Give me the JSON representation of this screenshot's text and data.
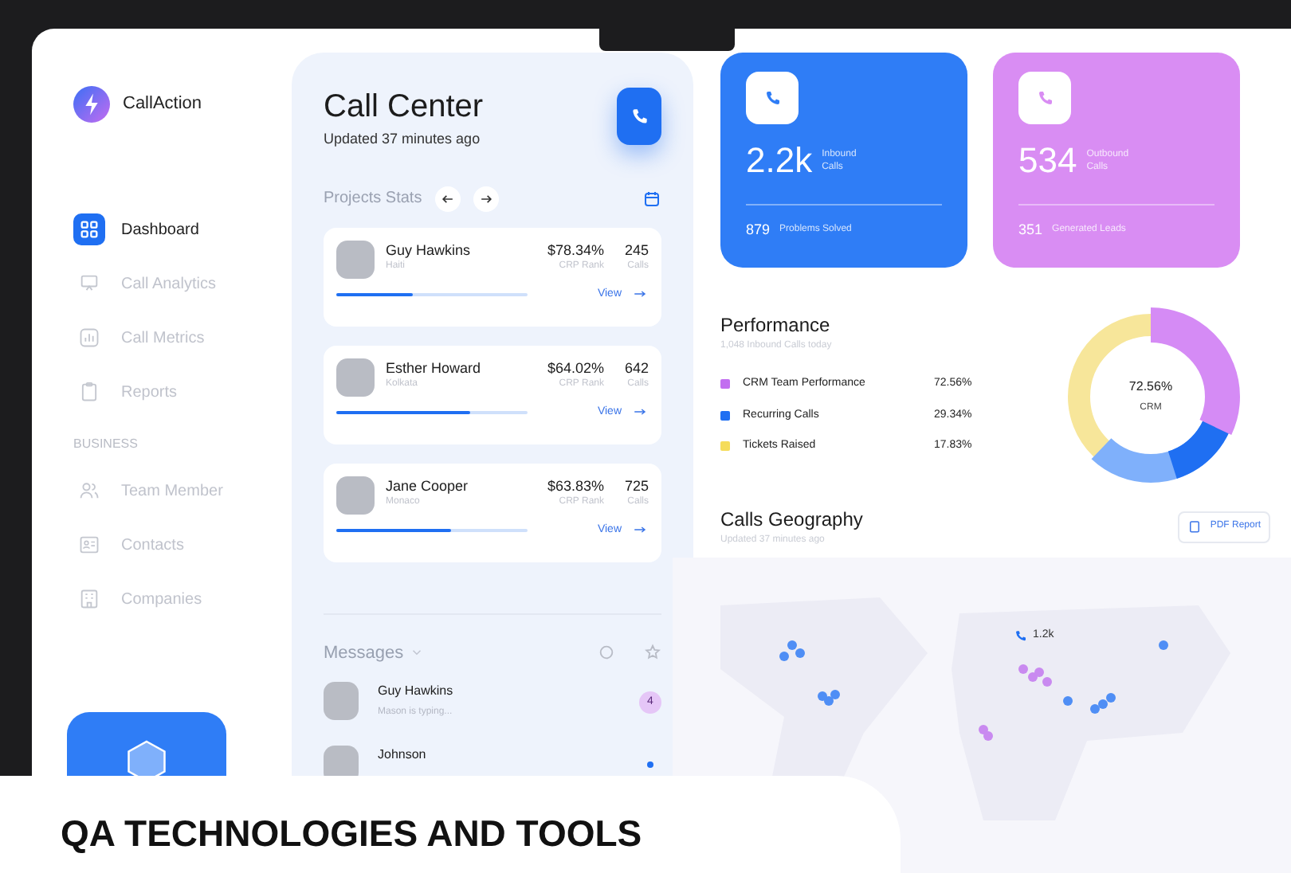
{
  "app": {
    "name": "CallAction"
  },
  "sidebar": {
    "items": [
      {
        "label": "Dashboard",
        "selected": true
      },
      {
        "label": "Call Analytics",
        "selected": false
      },
      {
        "label": "Call Metrics",
        "selected": false
      },
      {
        "label": "Reports",
        "selected": false
      }
    ],
    "section_label": "BUSINESS",
    "business_items": [
      {
        "label": "Team Member",
        "selected": false
      },
      {
        "label": "Contacts",
        "selected": false
      },
      {
        "label": "Companies",
        "selected": false
      }
    ]
  },
  "call_center": {
    "title": "Call Center",
    "subtitle": "Updated 37 minutes ago",
    "projects_title": "Projects Stats",
    "agents": [
      {
        "name": "Guy Hawkins",
        "location": "Haiti",
        "rate": "$78.34%",
        "rate_label": "CRP Rank",
        "calls": "245",
        "calls_label": "Calls",
        "level": 0.4,
        "link": "View"
      },
      {
        "name": "Esther Howard",
        "location": "Kolkata",
        "rate": "$64.02%",
        "rate_label": "CRP Rank",
        "calls": "642",
        "calls_label": "Calls",
        "level": 0.7,
        "link": "View"
      },
      {
        "name": "Jane Cooper",
        "location": "Monaco",
        "rate": "$63.83%",
        "rate_label": "CRP Rank",
        "calls": "725",
        "calls_label": "Calls",
        "level": 0.6,
        "link": "View"
      }
    ],
    "messages_title": "Messages",
    "messages": [
      {
        "name": "Guy Hawkins",
        "preview": "Mason is typing...",
        "badge": "4",
        "unread_dot": false
      },
      {
        "name": "Johnson",
        "unread_dot": true
      }
    ]
  },
  "stats": [
    {
      "value": "2.2k",
      "label": "Inbound Calls",
      "footer_value": "879",
      "footer_label": "Problems Solved",
      "color": "#2f7df6"
    },
    {
      "value": "534",
      "label": "Outbound Calls",
      "footer_value": "351",
      "footer_label": "Generated Leads",
      "color": "#d98df3"
    }
  ],
  "performance": {
    "title": "Performance",
    "subtitle": "1,048 Inbound Calls today",
    "legend": [
      {
        "label": "CRM Team Performance",
        "value": "72.56%",
        "color": "#c26ef0"
      },
      {
        "label": "Recurring Calls",
        "value": "29.34%",
        "color": "#1f6ff2"
      },
      {
        "label": "Tickets Raised",
        "value": "17.83%",
        "color": "#f5dc5a"
      }
    ],
    "donut_value": "72.56%",
    "donut_label": "CRM"
  },
  "geography": {
    "title": "Calls Geography",
    "subtitle": "Updated 37 minutes ago",
    "button": "PDF Report",
    "marker": "1.2k"
  },
  "overlay": {
    "heading": "QA TECHNOLOGIES AND TOOLS"
  }
}
